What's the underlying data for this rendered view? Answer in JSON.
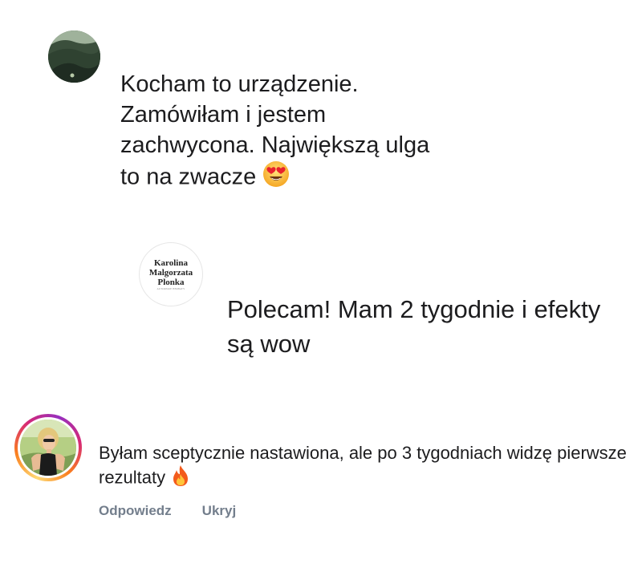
{
  "comments": [
    {
      "text": "Kocham to urządzenie. Zamówiłam i jestem zachwycona. Największą ulga to na zwacze",
      "emoji": "heart-eyes-face-icon"
    },
    {
      "avatar_logo": {
        "line1": "Karolina",
        "line2": "Malgorzata",
        "line3": "Plonka",
        "tagline": "AUTORSKIE HERBATY"
      },
      "text": "Polecam! Mam 2 tygodnie i efekty są wow"
    },
    {
      "text": "Byłam sceptycznie nastawiona, ale po 3 tygodniach widzę pierwsze rezultaty",
      "emoji": "fire-icon",
      "actions": {
        "reply": "Odpowiedz",
        "hide": "Ukryj"
      }
    }
  ],
  "colors": {
    "text": "#1c1c1e",
    "action_text": "#737e8c",
    "story_ring_start": "#feda75",
    "story_ring_mid": "#d62976",
    "story_ring_end": "#962fbf"
  }
}
